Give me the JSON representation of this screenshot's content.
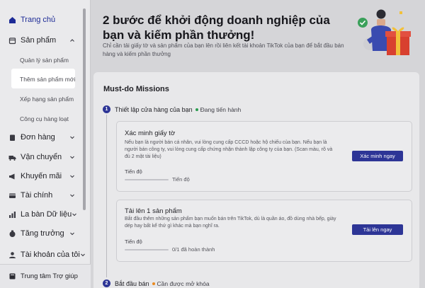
{
  "sidebar": {
    "home": "Trang chủ",
    "products": "Sản phẩm",
    "sub_items": [
      "Quản lý sản phẩm",
      "Thêm sản phẩm mới",
      "Xếp hạng sản phẩm",
      "Công cụ hàng loạt"
    ],
    "items": [
      {
        "label": "Đơn hàng",
        "icon": "orders-icon"
      },
      {
        "label": "Vận chuyển",
        "icon": "truck-icon"
      },
      {
        "label": "Khuyến mãi",
        "icon": "megaphone-icon"
      },
      {
        "label": "Tài chính",
        "icon": "finance-icon"
      },
      {
        "label": "La bàn Dữ liệu",
        "icon": "chart-icon"
      },
      {
        "label": "Tăng trưởng",
        "icon": "growth-icon"
      },
      {
        "label": "Tài khoản của tôi",
        "icon": "account-icon"
      }
    ],
    "help": "Trung tâm Trợ giúp"
  },
  "banner": {
    "title": "2 bước để khởi động doanh nghiệp của bạn và kiếm phần thưởng!",
    "description": "Chỉ cần tải giấy tờ và sản phẩm của bạn lên rồi liên kết tài khoản TikTok của bạn để bắt đầu bán hàng và kiếm phần thưởng"
  },
  "missions": {
    "title": "Must-do Missions",
    "step1": {
      "number": "1",
      "label": "Thiết lập cửa hàng của bạn",
      "status": "Đang tiến hành"
    },
    "step2": {
      "number": "2",
      "label": "Bắt đầu bán",
      "status": "Cần được mở khóa"
    },
    "tasks": [
      {
        "title": "Xác minh giấy tờ",
        "description": "Nếu bạn là người bán cá nhân, vui lòng cung cấp CCCD hoặc hộ chiếu của bạn. Nếu bạn là người bán công ty, vui lòng cung cấp chứng nhận thành lập công ty của bạn. (Scan màu, rõ và đủ 2 mặt tài liệu)",
        "button": "Xác minh ngay",
        "progress_label": "Tiến độ",
        "progress_text": "Tiến độ",
        "progress": 0
      },
      {
        "title": "Tải lên 1 sản phẩm",
        "description": "Bắt đầu thêm những sản phẩm bạn muốn bán trên TikTok, dù là quần áo, đồ dùng nhà bếp, giày dép hay bất kể thứ gì khác mà bạn nghĩ ra.",
        "button": "Tải lên ngay",
        "progress_label": "Tiến độ",
        "progress_text": "0/1 đã hoàn thành",
        "progress": 0
      }
    ]
  },
  "colors": {
    "accent": "#2d3596",
    "in_progress": "#2a9c4f",
    "locked": "#e98a20"
  }
}
